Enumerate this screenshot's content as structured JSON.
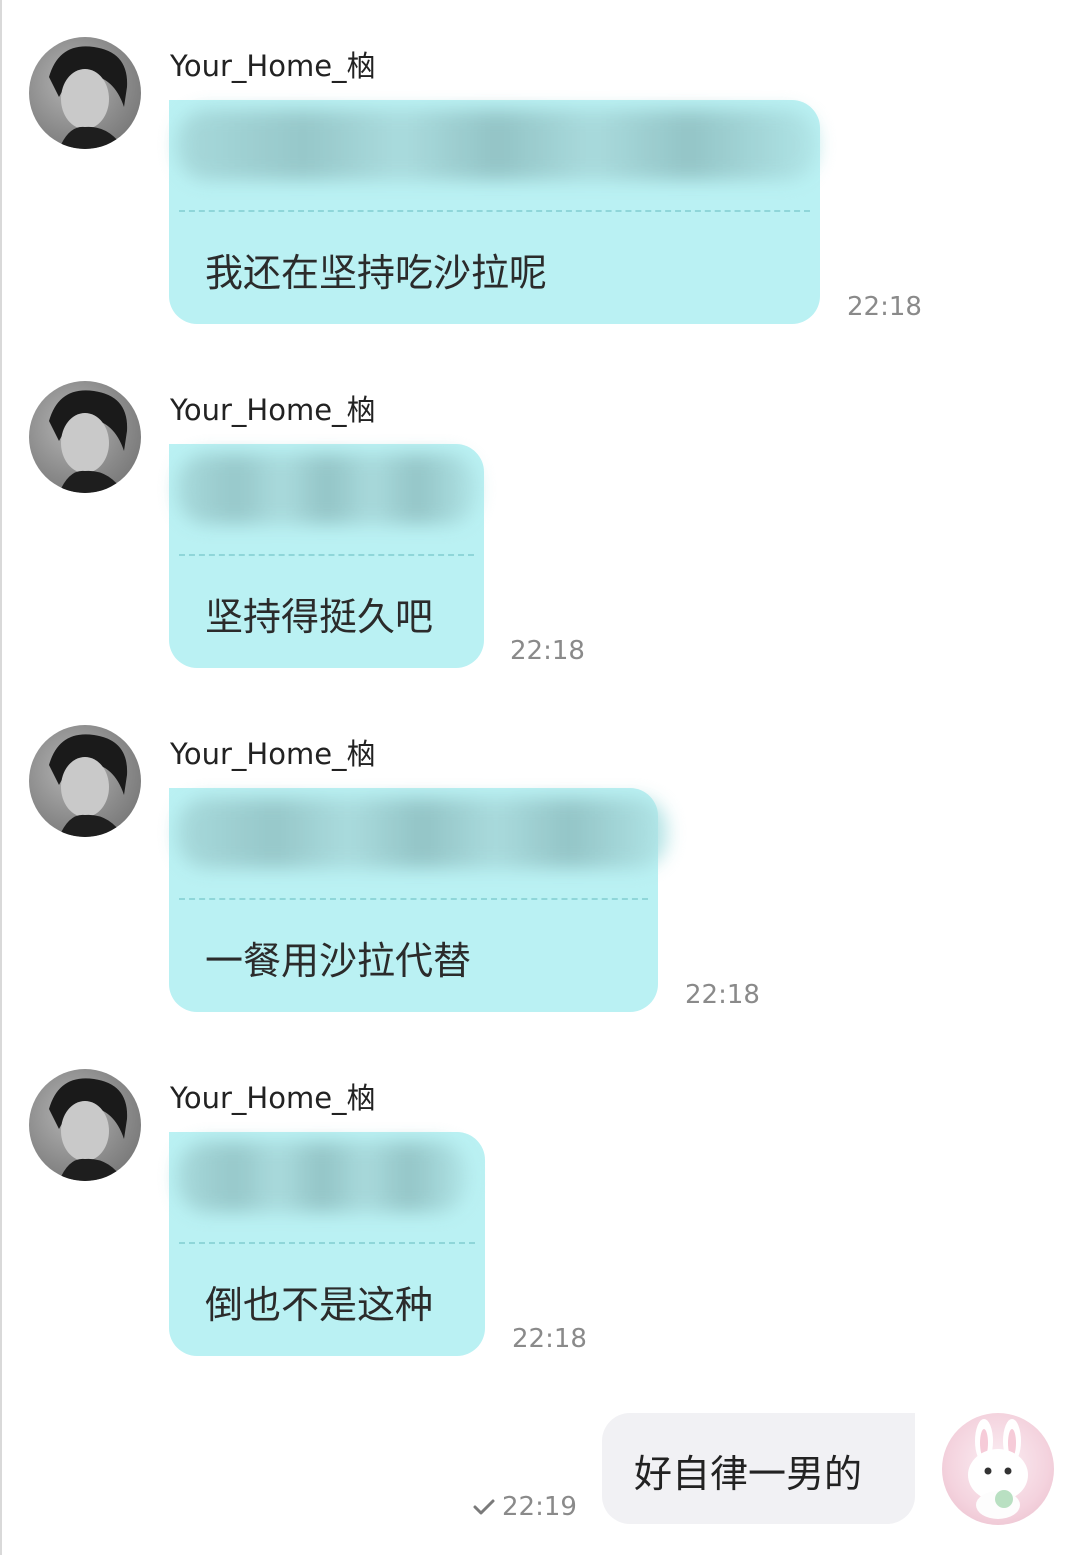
{
  "messages": [
    {
      "sender": "Your_Home_㭡",
      "reply": "我还在坚持吃沙拉呢",
      "time": "22:18"
    },
    {
      "sender": "Your_Home_㭡",
      "reply": "坚持得挺久吧",
      "time": "22:18"
    },
    {
      "sender": "Your_Home_㭡",
      "reply": "一餐用沙拉代替",
      "time": "22:18"
    },
    {
      "sender": "Your_Home_㭡",
      "reply": "倒也不是这种",
      "time": "22:18"
    }
  ],
  "outgoing": {
    "text": "好自律一男的",
    "time": "22:19",
    "status_icon": "check-icon"
  },
  "colors": {
    "incoming_bubble": "#baf1f3",
    "outgoing_bubble": "#f1f1f4",
    "timestamp": "#8a8a8a"
  }
}
